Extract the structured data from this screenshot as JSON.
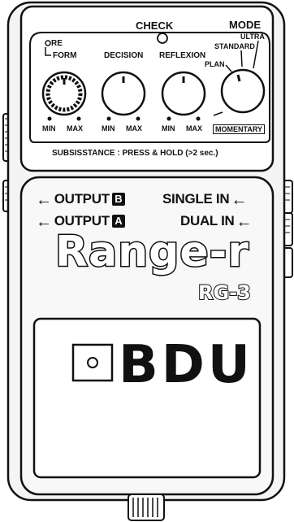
{
  "top_panel": {
    "check_label": "CHECK",
    "mode_label": "MODE",
    "mode_options": {
      "ultra": "ULTRA",
      "standard": "STANDARD",
      "plan": "PLAN",
      "momentary": "MOMENTARY"
    },
    "knobs": {
      "reform_line1": "RE",
      "reform_line2": "FORM",
      "decision": "DECISION",
      "reflexion": "REFLEXION",
      "min": "MIN",
      "max": "MAX"
    },
    "instruction": "SUBSISSTANCE : PRESS & HOLD (>2 sec.)"
  },
  "io": {
    "output_b": "OUTPUT",
    "output_b_badge": "B",
    "output_a": "OUTPUT",
    "output_a_badge": "A",
    "single_in": "SINGLE IN",
    "dual_in": "DUAL IN"
  },
  "branding": {
    "name": "Range-r",
    "model": "RG-3",
    "logo": "BDU"
  },
  "icons": [
    "arrow-left-icon",
    "knob-icon",
    "check-led-icon",
    "jack-icon",
    "footswitch-icon"
  ]
}
